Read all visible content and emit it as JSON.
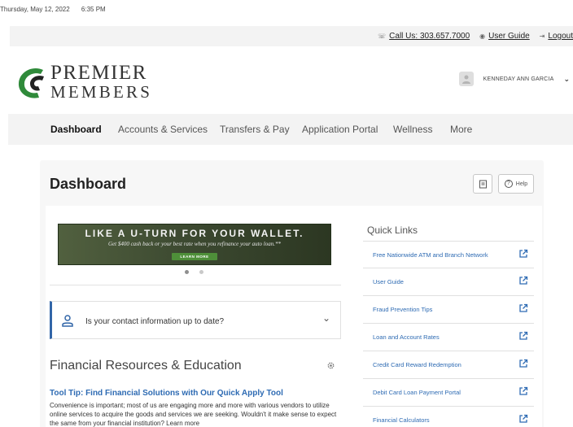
{
  "timestamp": {
    "date": "Thursday, May 12, 2022",
    "time": "6:35 PM"
  },
  "utility": {
    "call_label": "Call Us: 303.657.7000",
    "guide_label": "User Guide",
    "logout_label": "Logout",
    "icons": {
      "call": "phone-icon",
      "guide": "circle-icon",
      "logout": "logout-icon"
    }
  },
  "brand": {
    "line1": "PREMIER",
    "line2": "MEMBERS",
    "colors": {
      "mark": "#2f8a3a",
      "text": "#333333"
    }
  },
  "user": {
    "name": "KENNEDAY ANN GARCIA",
    "icon": "chevron-down-icon"
  },
  "nav": {
    "items": [
      {
        "label": "Dashboard",
        "active": true
      },
      {
        "label": "Accounts & Services"
      },
      {
        "label": "Transfers & Pay"
      },
      {
        "label": "Application Portal"
      },
      {
        "label": "Wellness"
      },
      {
        "label": "More"
      }
    ]
  },
  "page": {
    "title": "Dashboard",
    "help_label": "Help"
  },
  "banner": {
    "headline": "LIKE A U-TURN FOR YOUR WALLET.",
    "subtext": "Get $400 cash back or your best rate when you refinance your auto loan.**",
    "button_label": "LEARN MORE",
    "colors": {
      "background": "#3b4a2f",
      "button": "#4e8f39"
    }
  },
  "carousel": {
    "slide_count": 2,
    "active_slide": 1
  },
  "contact": {
    "text": "Is your contact information up to date?"
  },
  "resources": {
    "title": "Financial Resources & Education",
    "article_title": "Tool Tip: Find Financial Solutions with Our Quick Apply Tool",
    "article_body": "Convenience is important; most of us are engaging more and more with various vendors to utilize online services to acquire the goods and services we are seeking. Wouldn't it make sense to expect the same from your financial institution? Learn more"
  },
  "quick_links": {
    "title": "Quick Links",
    "items": [
      {
        "label": "Free Nationwide ATM and Branch Network"
      },
      {
        "label": "User Guide"
      },
      {
        "label": "Fraud Prevention Tips"
      },
      {
        "label": "Loan and Account Rates"
      },
      {
        "label": "Credit Card Reward Redemption"
      },
      {
        "label": "Debit Card Loan Payment Portal"
      },
      {
        "label": "Financial Calculators"
      }
    ]
  },
  "colors": {
    "accent": "#2e6bb3",
    "contact_border": "#3266a8",
    "nav_bg": "#f3f3f3"
  }
}
